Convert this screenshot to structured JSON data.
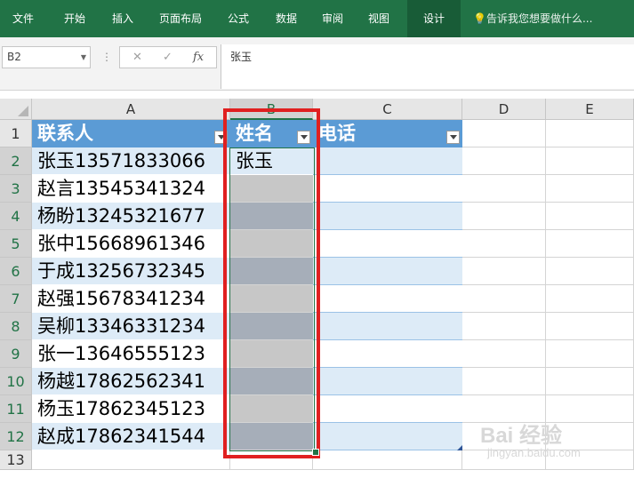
{
  "ribbon": {
    "tabs": [
      "文件",
      "开始",
      "插入",
      "页面布局",
      "公式",
      "数据",
      "审阅",
      "视图",
      "设计"
    ],
    "active_tab": "设计",
    "tell_me": "告诉我您想要做什么..."
  },
  "formula_bar": {
    "name_box": "B2",
    "cancel_glyph": "✕",
    "enter_glyph": "✓",
    "fx_glyph": "fx",
    "content": "张玉"
  },
  "columns": [
    "A",
    "B",
    "C",
    "D",
    "E"
  ],
  "rows": [
    "1",
    "2",
    "3",
    "4",
    "5",
    "6",
    "7",
    "8",
    "9",
    "10",
    "11",
    "12",
    "13"
  ],
  "table": {
    "headers": [
      "联系人",
      "姓名",
      "电话"
    ],
    "contacts": [
      "张玉13571833066",
      "赵言13545341324",
      "杨盼13245321677",
      "张中15668961346",
      "于成13256732345",
      "赵强15678341234",
      "吴柳13346331234",
      "张一13646555123",
      "杨越17862562341",
      "杨玉17862345123",
      "赵成17862341544"
    ],
    "names": [
      "张玉",
      "",
      "",
      "",
      "",
      "",
      "",
      "",
      "",
      "",
      ""
    ]
  },
  "watermark": {
    "main": "Bai 经验",
    "sub": "jingyan.baidu.com"
  },
  "colors": {
    "ribbon": "#217346",
    "table_header": "#5b9bd5",
    "band": "#ddebf7",
    "highlight": "#e02020",
    "selection": "#a6aeb9"
  }
}
